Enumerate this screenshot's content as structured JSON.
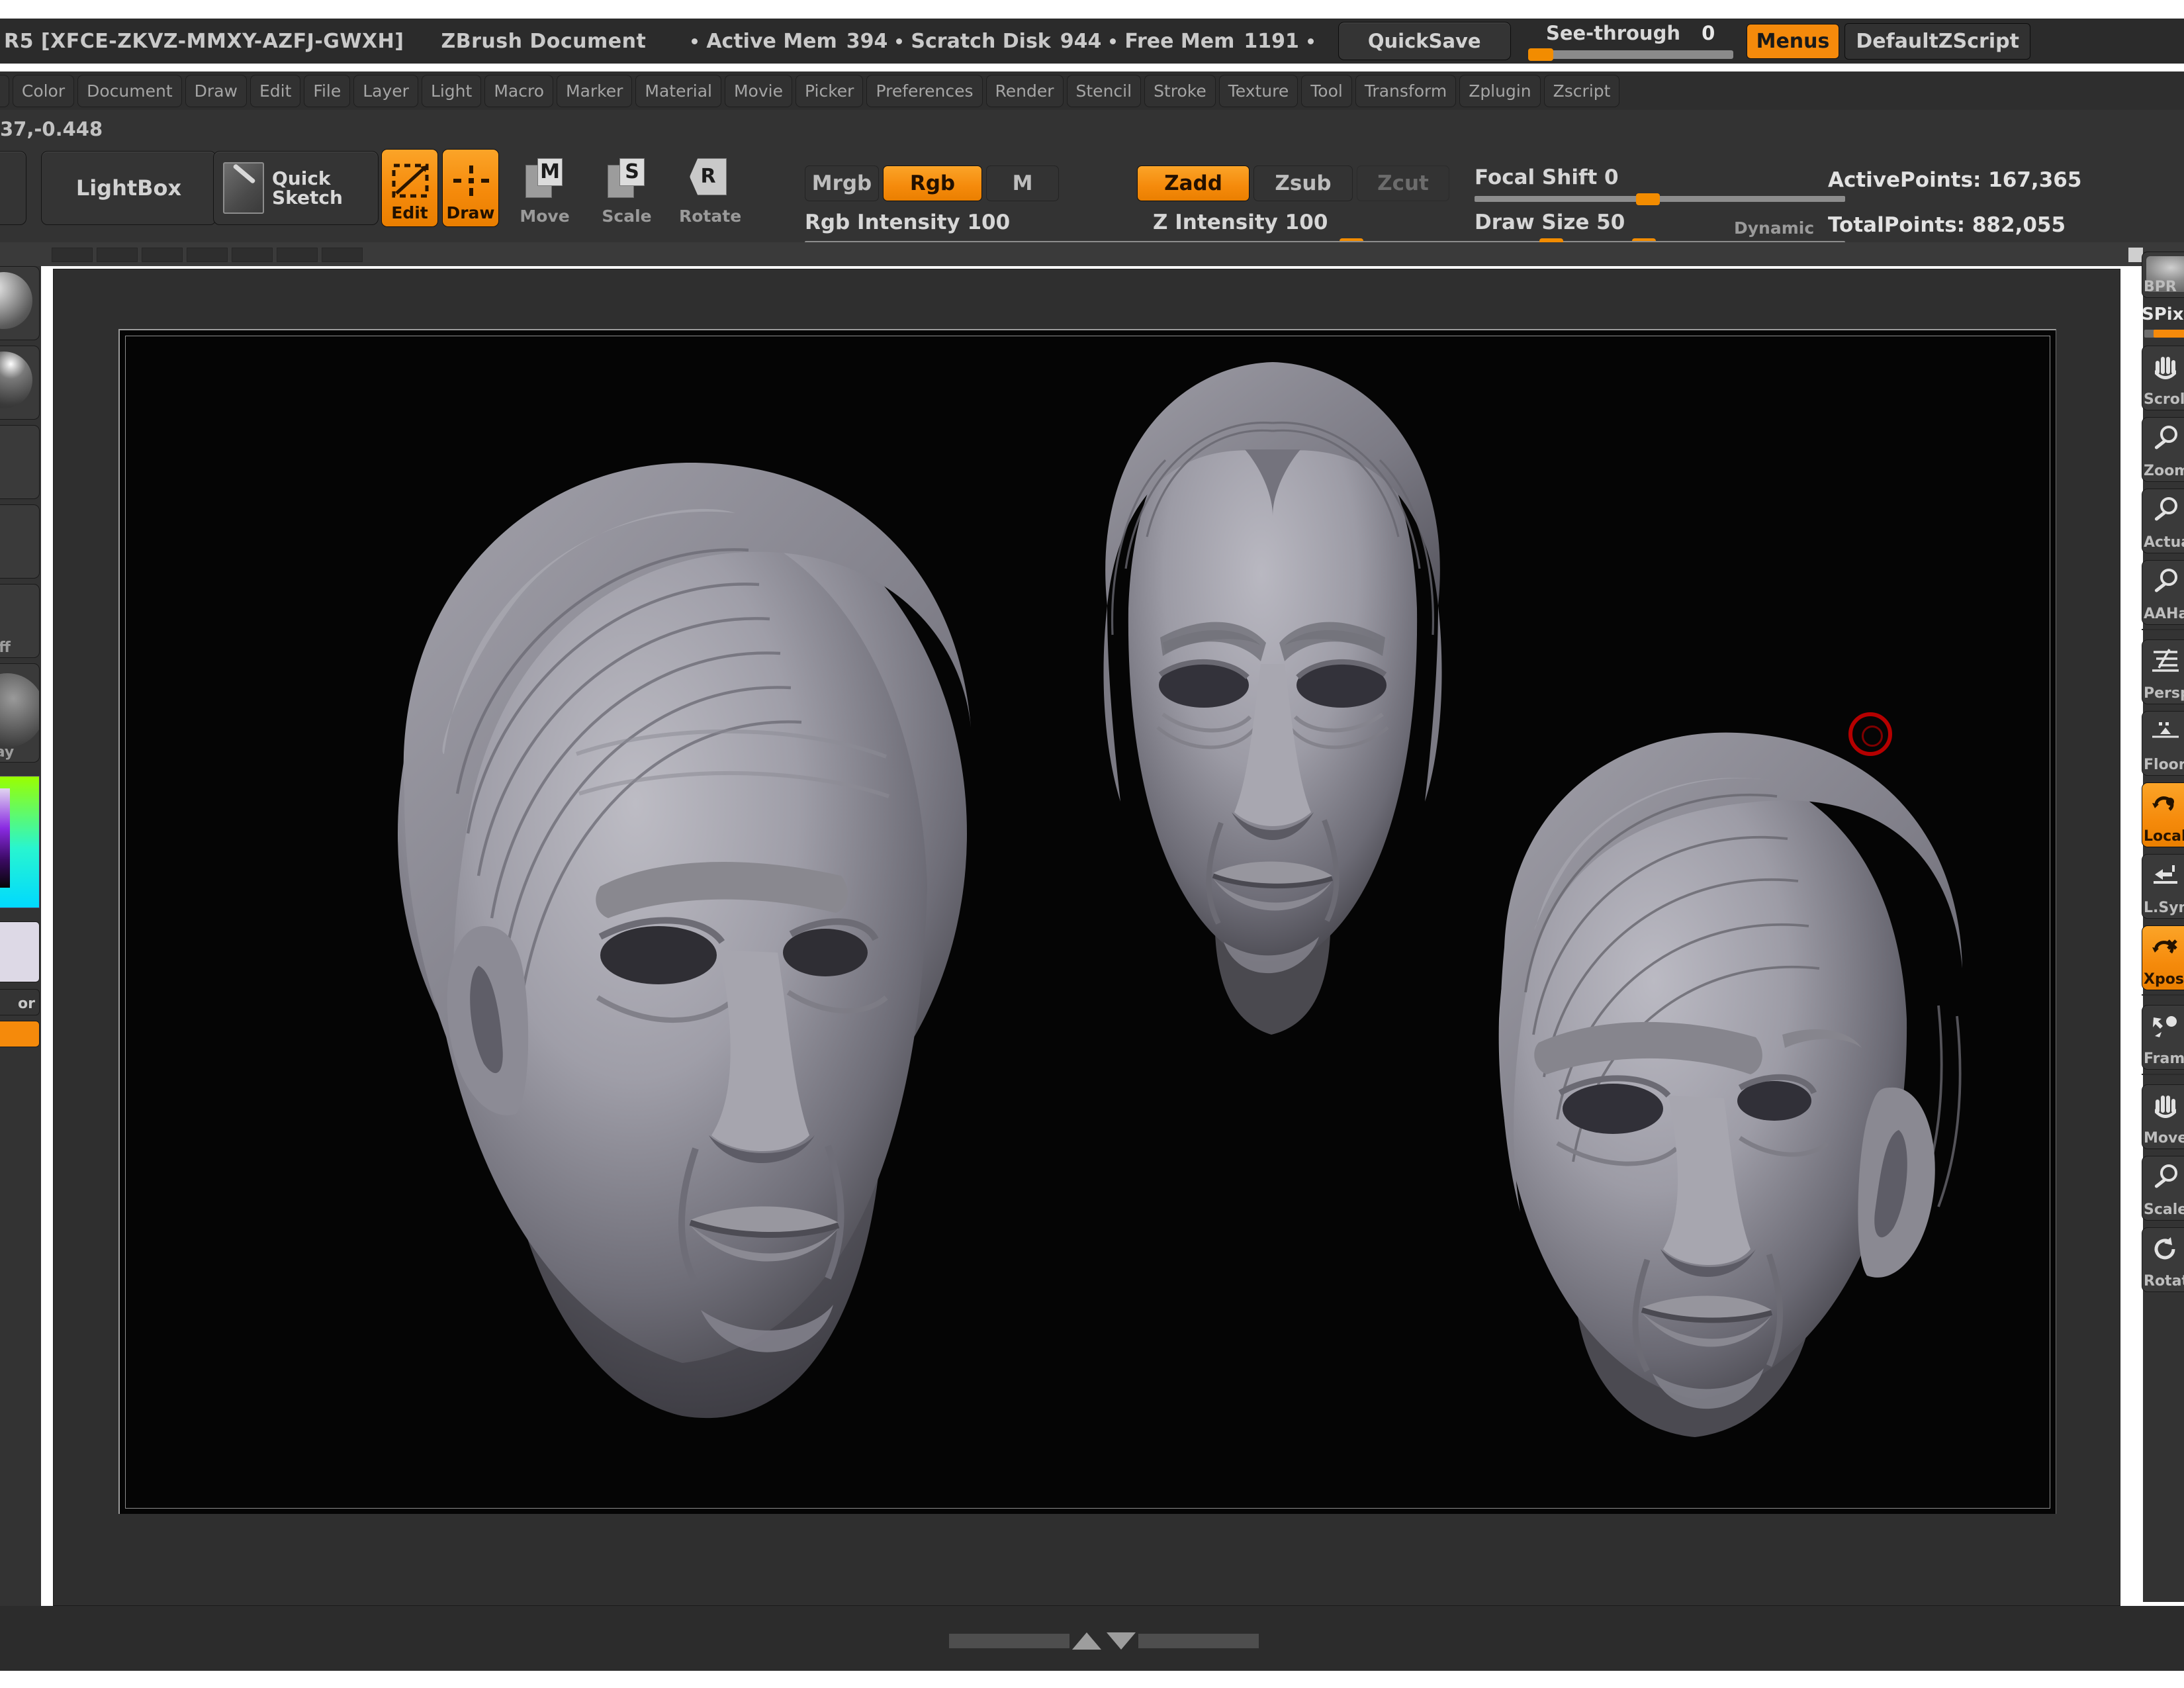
{
  "app": {
    "title_license": "R5  [XFCE-ZKVZ-MMXY-AZFJ-GWXH]",
    "document_title": "ZBrush Document",
    "active_mem_label": "Active Mem",
    "active_mem_value": "394",
    "scratch_disk_label": "Scratch Disk",
    "scratch_disk_value": "944",
    "free_mem_label": "Free Mem",
    "free_mem_value": "1191",
    "quicksave_label": "QuickSave",
    "seethrough_label": "See-through",
    "seethrough_value": "0",
    "menus_label": "Menus",
    "zscript_label": "DefaultZScript",
    "accent_orange": "#f58a0b",
    "panel_gray": "#333333",
    "canvas_black": "#050505"
  },
  "menubar": {
    "items": [
      "h",
      "Color",
      "Document",
      "Draw",
      "Edit",
      "File",
      "Layer",
      "Light",
      "Macro",
      "Marker",
      "Material",
      "Movie",
      "Picker",
      "Preferences",
      "Render",
      "Stencil",
      "Stroke",
      "Texture",
      "Tool",
      "Transform",
      "Zplugin",
      "Zscript"
    ]
  },
  "toolbar": {
    "coord_readout": "37,-0.448",
    "lightbox_label": "LightBox",
    "quicksketch_label_line1": "Quick",
    "quicksketch_label_line2": "Sketch",
    "edit_label": "Edit",
    "draw_label": "Draw",
    "move_label": "Move",
    "move_glyph": "M",
    "scale_label": "Scale",
    "scale_glyph": "S",
    "rotate_label": "Rotate",
    "rotate_glyph": "R",
    "mrgb_label": "Mrgb",
    "rgb_label": "Rgb",
    "m_label": "M",
    "zadd_label": "Zadd",
    "zsub_label": "Zsub",
    "zcut_label": "Zcut",
    "rgb_intensity_label": "Rgb Intensity 100",
    "z_intensity_label": "Z Intensity 100",
    "focal_shift_label": "Focal Shift 0",
    "draw_size_label": "Draw Size 50",
    "dynamic_label": "Dynamic",
    "active_points_label": "ActivePoints: 167,365",
    "total_points_label": "TotalPoints: 882,055"
  },
  "right_palette": {
    "items": [
      {
        "label": "BPR",
        "icon": "bpr-preview",
        "active": false
      },
      {
        "label": "SPix",
        "icon": "spix-slider",
        "active": false
      },
      {
        "label": "Scroll",
        "icon": "hand-icon",
        "active": false
      },
      {
        "label": "Zoom",
        "icon": "magnifier-icon",
        "active": false
      },
      {
        "label": "Actual",
        "icon": "magnifier-icon",
        "active": false
      },
      {
        "label": "AAHalf",
        "icon": "magnifier-icon",
        "active": false
      },
      {
        "label": "Persp",
        "icon": "perspective-icon",
        "active": false
      },
      {
        "label": "Floor",
        "icon": "floor-grid-icon",
        "active": false
      },
      {
        "label": "Local",
        "icon": "local-pivot-icon",
        "active": true
      },
      {
        "label": "L.Sym",
        "icon": "local-sym-icon",
        "active": false
      },
      {
        "label": "Xpose",
        "icon": "xpose-icon",
        "active": true
      },
      {
        "label": "Frame",
        "icon": "frame-icon",
        "active": false
      },
      {
        "label": "Move",
        "icon": "hand-icon",
        "active": false
      },
      {
        "label": "Scale",
        "icon": "magnifier-icon",
        "active": false
      },
      {
        "label": "Rotate",
        "icon": "rotate-icon",
        "active": false
      }
    ]
  },
  "left_palette": {
    "items": [
      {
        "name": "material-sphere-1",
        "type": "sphere"
      },
      {
        "name": "material-sphere-2",
        "type": "sphere-lit"
      },
      {
        "name": "alpha-slot",
        "type": "blank"
      },
      {
        "name": "texture-slot",
        "type": "blank"
      },
      {
        "name": "stroke-slot",
        "type": "blank-off",
        "caption": "ff"
      },
      {
        "name": "material-slot",
        "type": "sphere-big",
        "caption": "ay"
      },
      {
        "name": "color-picker",
        "type": "colorwheel"
      },
      {
        "name": "color-swatch",
        "type": "swatch"
      },
      {
        "name": "secondary-color",
        "type": "strip",
        "caption": "or"
      },
      {
        "name": "switch-color",
        "type": "orange-strip"
      }
    ]
  },
  "canvas": {
    "brush_cursor_color": "#b50000",
    "subjects": "three sculpted male head busts, gray clay material on black background"
  },
  "bottom": {
    "tray_hint": "tray-expander"
  }
}
